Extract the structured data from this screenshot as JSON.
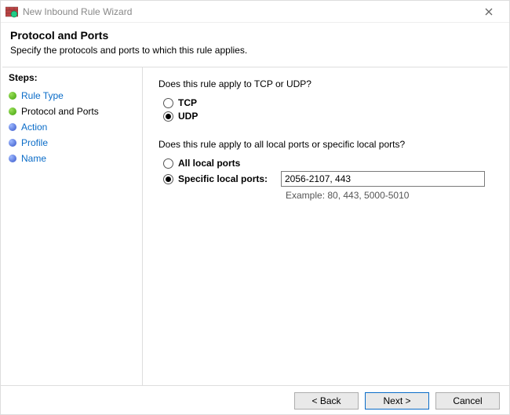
{
  "window": {
    "title": "New Inbound Rule Wizard"
  },
  "header": {
    "title": "Protocol and Ports",
    "subtitle": "Specify the protocols and ports to which this rule applies."
  },
  "steps": {
    "heading": "Steps:",
    "items": [
      {
        "label": "Rule Type"
      },
      {
        "label": "Protocol and Ports"
      },
      {
        "label": "Action"
      },
      {
        "label": "Profile"
      },
      {
        "label": "Name"
      }
    ]
  },
  "content": {
    "question1": "Does this rule apply to TCP or UDP?",
    "tcp_label": "TCP",
    "udp_label": "UDP",
    "question2": "Does this rule apply to all local ports or specific local ports?",
    "all_ports_label": "All local ports",
    "specific_ports_label": "Specific local ports:",
    "ports_value": "2056-2107, 443",
    "example": "Example: 80, 443, 5000-5010"
  },
  "buttons": {
    "back": "< Back",
    "next": "Next >",
    "cancel": "Cancel"
  }
}
